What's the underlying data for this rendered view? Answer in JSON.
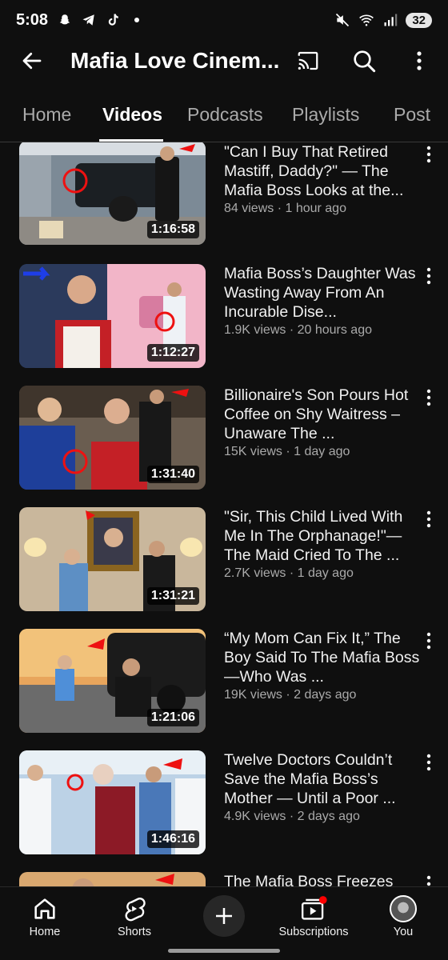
{
  "status_bar": {
    "time": "5:08",
    "battery": "32",
    "left_icons": [
      "snapchat-icon",
      "telegram-icon",
      "tiktok-icon",
      "dot-icon"
    ],
    "right_icons": [
      "mute-icon",
      "wifi-icon",
      "signal-icon"
    ]
  },
  "header": {
    "title": "Mafia Love Cinem..."
  },
  "tabs": [
    {
      "label": "Home"
    },
    {
      "label": "Videos"
    },
    {
      "label": "Podcasts"
    },
    {
      "label": "Playlists"
    },
    {
      "label": "Post"
    }
  ],
  "active_tab": "Videos",
  "videos": [
    {
      "title": "\"Can I Buy That Retired Mastiff, Daddy?\" — The Mafia Boss Looks at the...",
      "views": "84 views",
      "age": "1 hour ago",
      "duration": "1:16:58"
    },
    {
      "title": "Mafia Boss’s Daughter Was Wasting Away From An Incurable Dise...",
      "views": "1.9K views",
      "age": "20 hours ago",
      "duration": "1:12:27"
    },
    {
      "title": "Billionaire's Son Pours Hot Coffee on Shy Waitress –Unaware The ...",
      "views": "15K views",
      "age": "1 day ago",
      "duration": "1:31:40"
    },
    {
      "title": "\"Sir, This Child Lived With Me In The Orphanage!\"—The Maid Cried To The ...",
      "views": "2.7K views",
      "age": "1 day ago",
      "duration": "1:31:21"
    },
    {
      "title": "“My Mom Can Fix It,” The Boy Said To The Mafia Boss—Who Was ...",
      "views": "19K views",
      "age": "2 days ago",
      "duration": "1:21:06"
    },
    {
      "title": "Twelve Doctors Couldn’t Save the Mafia Boss’s Mother — Until a Poor ...",
      "views": "4.9K views",
      "age": "2 days ago",
      "duration": "1:46:16"
    },
    {
      "title": "The Mafia Boss Freezes",
      "views": "",
      "age": "",
      "duration": ""
    }
  ],
  "meta_separator": " · ",
  "bottom_nav": {
    "home": "Home",
    "shorts": "Shorts",
    "subscriptions": "Subscriptions",
    "you": "You"
  },
  "colors": {
    "background": "#0f0f0f",
    "text_primary": "#f1f1f1",
    "text_secondary": "#aaaaaa",
    "notification_dot": "#ff0000"
  }
}
